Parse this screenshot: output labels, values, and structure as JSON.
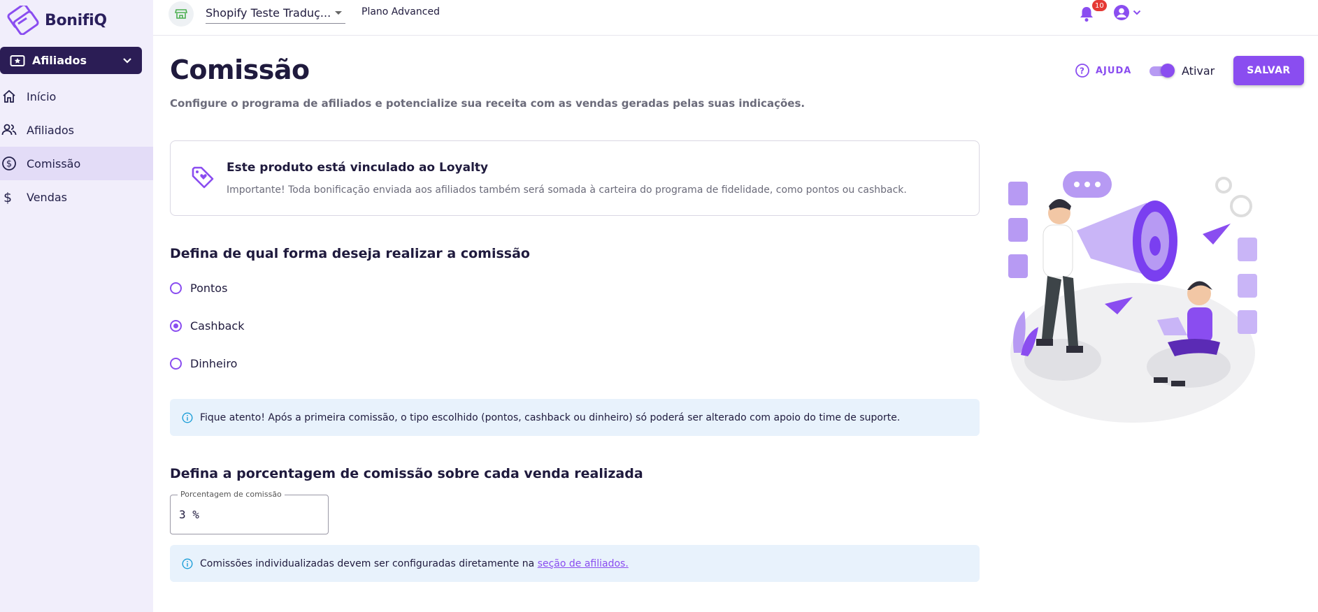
{
  "brand": {
    "name": "BonifiQ",
    "accent": "#8a4df0",
    "dark": "#2b1d55"
  },
  "sidebar": {
    "product_select": {
      "label": "Afiliados",
      "icon": "ticket-icon"
    },
    "items": [
      {
        "label": "Início",
        "icon": "home-icon",
        "active": false
      },
      {
        "label": "Afiliados",
        "icon": "users-icon",
        "active": false
      },
      {
        "label": "Comissão",
        "icon": "dollar-circle-icon",
        "active": true
      },
      {
        "label": "Vendas",
        "icon": "dollar-icon",
        "active": false
      }
    ]
  },
  "topbar": {
    "store_name": "Shopify Teste Traduç...",
    "plan": "Plano Advanced",
    "notifications_count": "10"
  },
  "header": {
    "title": "Comissão",
    "subtitle": "Configure o programa de afiliados e potencialize sua receita com as vendas geradas pelas suas indicações.",
    "help_label": "AJUDA",
    "toggle_label": "Ativar",
    "toggle_on": true,
    "save_label": "SALVAR"
  },
  "loyalty_card": {
    "title": "Este produto está vinculado ao Loyalty",
    "text": "Importante! Toda bonificação enviada aos afiliados também será somada à carteira do programa de fidelidade, como pontos ou cashback."
  },
  "commission_type": {
    "title": "Defina de qual forma deseja realizar a comissão",
    "options": [
      {
        "label": "Pontos",
        "checked": false
      },
      {
        "label": "Cashback",
        "checked": true
      },
      {
        "label": "Dinheiro",
        "checked": false
      }
    ],
    "notice": "Fique atento! Após a primeira comissão, o tipo escolhido (pontos, cashback ou dinheiro) só poderá ser alterado com apoio do time de suporte."
  },
  "commission_percentage": {
    "title": "Defina a porcentagem de comissão sobre cada venda realizada",
    "field_label": "Porcentagem de comissão",
    "value": "3 %",
    "notice_text": "Comissões individualizadas devem ser configuradas diretamente na ",
    "notice_link": "seção de afiliados."
  }
}
